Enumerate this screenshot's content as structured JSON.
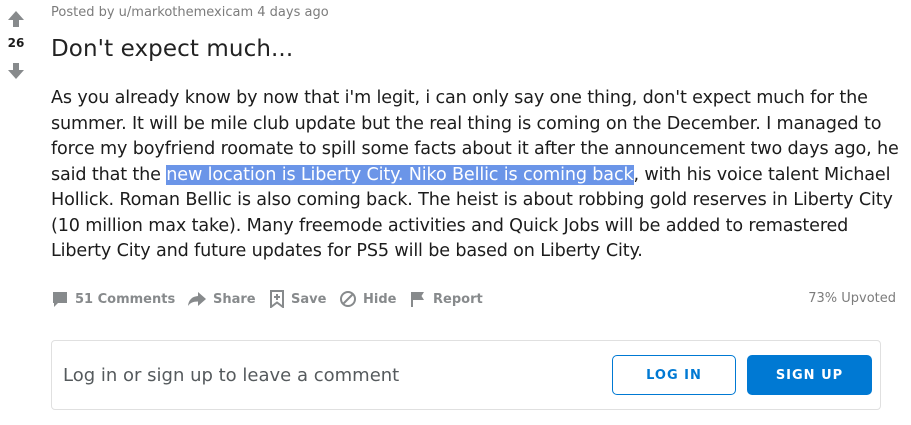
{
  "vote": {
    "score": "26"
  },
  "post": {
    "meta": "Posted by u/markothemexicam 4 days ago",
    "title": "Don't expect much...",
    "body_before": "As you already know by now that i'm legit, i can only say one thing, don't expect much for the summer. It will be mile club update but the real thing is coming on the December. I managed to force my boyfriend roomate to spill some facts about it after the announcement two days ago, he said that the ",
    "body_highlight": "new location is Liberty City. Niko Bellic is coming back",
    "body_after": ", with his voice talent Michael Hollick. Roman Bellic is also coming back. The heist is about robbing gold reserves in Liberty City (10 million max take). Many freemode activities and Quick Jobs will be added to remastered Liberty City and future updates for PS5 will be based on Liberty City."
  },
  "actions": {
    "comments": "51 Comments",
    "share": "Share",
    "save": "Save",
    "hide": "Hide",
    "report": "Report",
    "upvoted": "73% Upvoted"
  },
  "comment_box": {
    "prompt": "Log in or sign up to leave a comment",
    "login_label": "LOG IN",
    "signup_label": "SIGN UP"
  },
  "colors": {
    "accent": "#0079d3",
    "highlight": "#6b95e8",
    "muted": "#878a8c"
  },
  "icons": [
    "upvote-arrow-icon",
    "downvote-arrow-icon",
    "comment-icon",
    "share-icon",
    "save-icon",
    "hide-icon",
    "report-flag-icon"
  ]
}
